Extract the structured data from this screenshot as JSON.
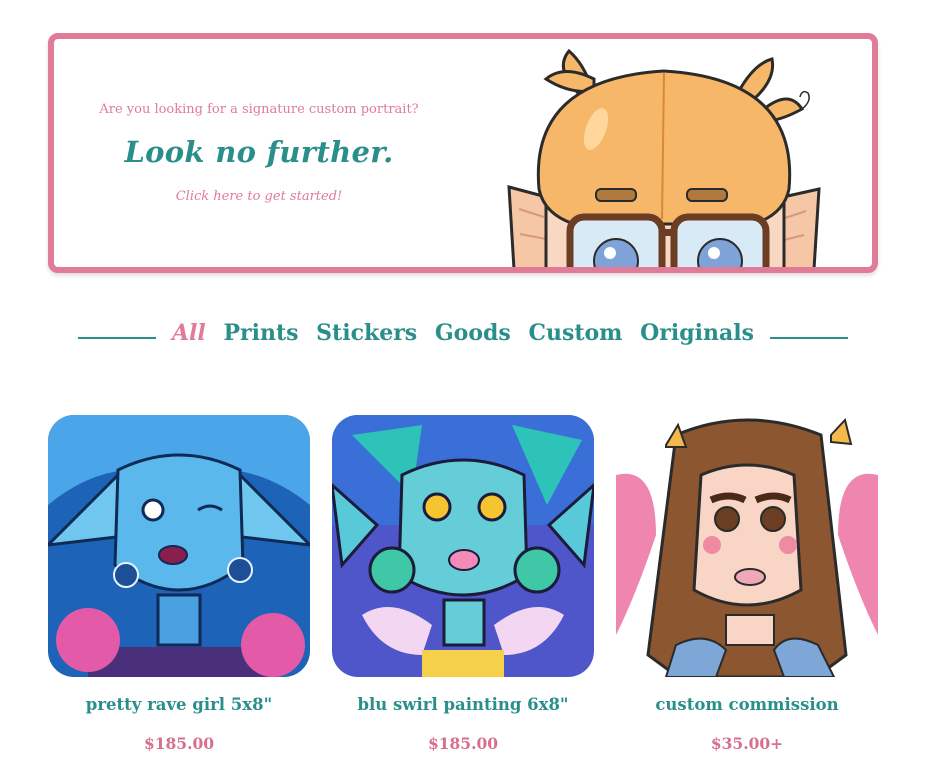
{
  "banner": {
    "subtitle": "Are you looking for a signature custom portrait?",
    "headline": "Look no further.",
    "cta": "Click here to get started!",
    "accent_color": "#e07b98",
    "headline_color": "#2a8f8a"
  },
  "filters": {
    "items": [
      "All",
      "Prints",
      "Stickers",
      "Goods",
      "Custom",
      "Originals"
    ],
    "active": "All"
  },
  "products": [
    {
      "title": "pretty rave girl 5x8\"",
      "price": "$185.00"
    },
    {
      "title": "blu swirl painting 6x8\"",
      "price": "$185.00"
    },
    {
      "title": "custom commission",
      "price": "$35.00+"
    }
  ],
  "colors": {
    "pink": "#e07b98",
    "teal": "#2a8f8a",
    "price": "#d86f8d"
  }
}
